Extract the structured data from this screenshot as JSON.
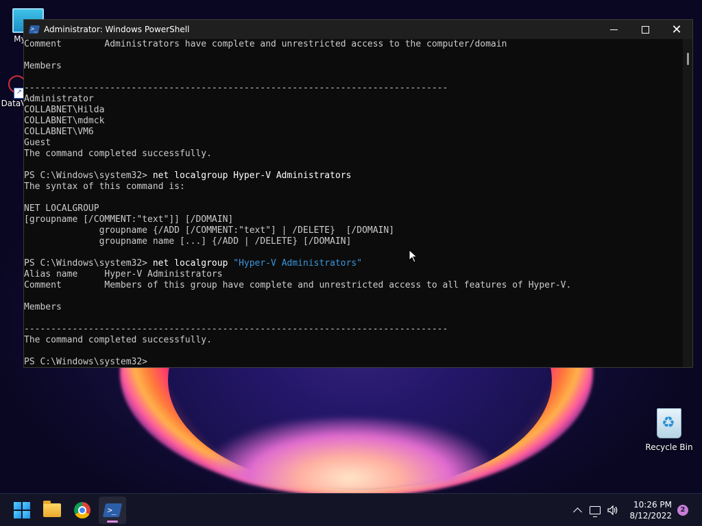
{
  "desktop": {
    "icons": [
      {
        "label": "My C"
      },
      {
        "label": "DataV"
      },
      {
        "label": "Recycle Bin"
      }
    ]
  },
  "window": {
    "title": "Administrator: Windows PowerShell",
    "controls": {
      "minimize": "",
      "maximize": "",
      "close": "✕"
    }
  },
  "console": {
    "lines": [
      "Comment        Administrators have complete and unrestricted access to the computer/domain",
      "",
      "Members",
      "",
      "-------------------------------------------------------------------------------",
      "Administrator",
      "COLLABNET\\Hilda",
      "COLLABNET\\mdmck",
      "COLLABNET\\VM6",
      "Guest",
      "The command completed successfully.",
      "",
      "PS C:\\Windows\\system32> net localgroup Hyper-V Administrators",
      "The syntax of this command is:",
      "",
      "NET LOCALGROUP",
      "[groupname [/COMMENT:\"text\"]] [/DOMAIN]",
      "              groupname {/ADD [/COMMENT:\"text\"] | /DELETE}  [/DOMAIN]",
      "              groupname name [...] {/ADD | /DELETE} [/DOMAIN]",
      "",
      "PS C:\\Windows\\system32> net localgroup \"Hyper-V Administrators\"",
      "Alias name     Hyper-V Administrators",
      "Comment        Members of this group have complete and unrestricted access to all features of Hyper-V.",
      "",
      "Members",
      "",
      "-------------------------------------------------------------------------------",
      "The command completed successfully.",
      "",
      "PS C:\\Windows\\system32>"
    ],
    "prompt": "PS C:\\Windows\\system32>",
    "cmd1_rest": " net localgroup Hyper-V Administrators",
    "cmd2_plain": " net localgroup ",
    "cmd2_string": "\"Hyper-V Administrators\""
  },
  "taskbar": {
    "apps": [
      {
        "name": "Start"
      },
      {
        "name": "File Explorer"
      },
      {
        "name": "Google Chrome"
      },
      {
        "name": "Windows PowerShell"
      }
    ],
    "clock": {
      "time": "10:26 PM",
      "date": "8/12/2022"
    },
    "notifications": "2"
  },
  "colors": {
    "console_bg": "#0c0c0c",
    "console_text": "#cccccc",
    "string_color": "#3a96dd",
    "accent": "#e38ce8"
  },
  "icons": [
    "powershell-icon",
    "minimize-icon",
    "maximize-icon",
    "close-icon",
    "windows-start-icon",
    "folder-icon",
    "chrome-icon",
    "chevron-up-icon",
    "network-icon",
    "volume-icon",
    "recycle-bin-icon"
  ]
}
